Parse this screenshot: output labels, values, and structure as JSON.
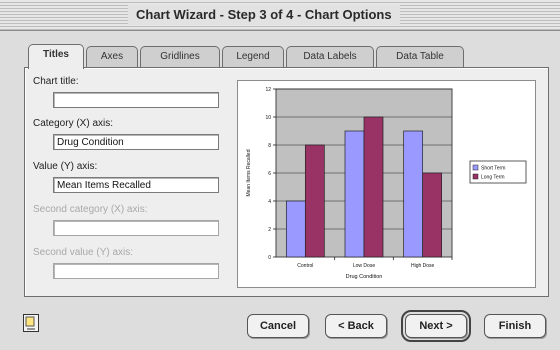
{
  "window": {
    "title": "Chart Wizard - Step 3 of 4 - Chart Options"
  },
  "tabs": [
    {
      "label": "Titles",
      "active": true
    },
    {
      "label": "Axes",
      "active": false
    },
    {
      "label": "Gridlines",
      "active": false
    },
    {
      "label": "Legend",
      "active": false
    },
    {
      "label": "Data Labels",
      "active": false
    },
    {
      "label": "Data Table",
      "active": false
    }
  ],
  "fields": {
    "chart_title": {
      "label": "Chart title:",
      "value": ""
    },
    "category_x": {
      "label": "Category (X) axis:",
      "value": "Drug Condition"
    },
    "value_y": {
      "label": "Value (Y) axis:",
      "value": "Mean Items Recalled"
    },
    "second_category_x": {
      "label": "Second category (X) axis:",
      "value": ""
    },
    "second_value_y": {
      "label": "Second value (Y) axis:",
      "value": ""
    }
  },
  "buttons": {
    "cancel": "Cancel",
    "back": "< Back",
    "next": "Next >",
    "finish": "Finish"
  },
  "chart_data": {
    "type": "bar",
    "categories": [
      "Control",
      "Low Dose",
      "High Dose"
    ],
    "series": [
      {
        "name": "Short Term",
        "values": [
          4,
          9,
          9
        ],
        "color": "#9999ff"
      },
      {
        "name": "Long Term",
        "values": [
          8,
          10,
          6
        ],
        "color": "#993366"
      }
    ],
    "xlabel": "Drug Condition",
    "ylabel": "Mean Items Recalled",
    "ylim": [
      0,
      12
    ],
    "yticks": [
      0,
      2,
      4,
      6,
      8,
      10,
      12
    ],
    "plot_background": "#c0c0c0",
    "grid": true,
    "legend_position": "right"
  }
}
